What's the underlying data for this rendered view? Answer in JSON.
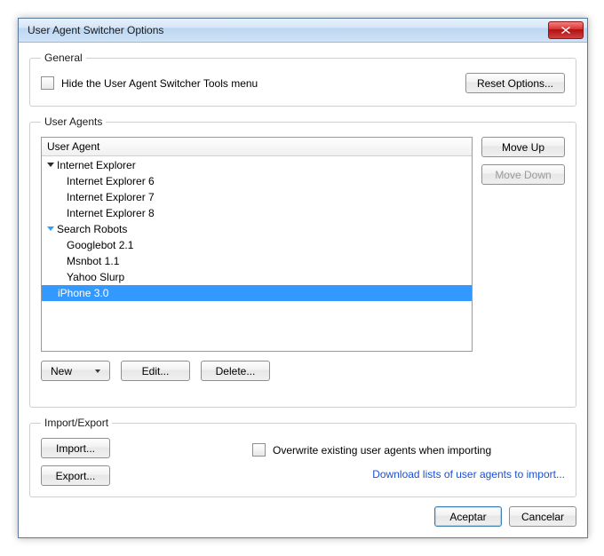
{
  "title": "User Agent Switcher Options",
  "general": {
    "legend": "General",
    "hide_label": "Hide the User Agent Switcher Tools menu",
    "reset_label": "Reset Options..."
  },
  "ua": {
    "legend": "User Agents",
    "header": "User Agent",
    "move_up": "Move Up",
    "move_down": "Move Down",
    "new": "New",
    "edit": "Edit...",
    "delete": "Delete...",
    "groups": [
      {
        "label": "Internet Explorer",
        "twist": "black",
        "items": [
          "Internet Explorer 6",
          "Internet Explorer 7",
          "Internet Explorer 8"
        ]
      },
      {
        "label": "Search Robots",
        "twist": "blue",
        "items": [
          "Googlebot 2.1",
          "Msnbot 1.1",
          "Yahoo Slurp"
        ]
      }
    ],
    "selected": "iPhone 3.0"
  },
  "ie": {
    "legend": "Import/Export",
    "import": "Import...",
    "export": "Export...",
    "overwrite": "Overwrite existing user agents when importing",
    "download": "Download lists of user agents to import..."
  },
  "buttons": {
    "ok": "Aceptar",
    "cancel": "Cancelar"
  }
}
